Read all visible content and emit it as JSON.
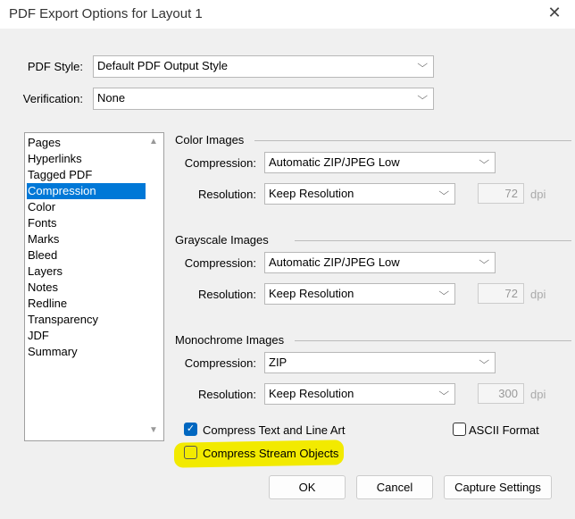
{
  "title": "PDF Export Options for Layout 1",
  "pdf_style": {
    "label": "PDF Style:",
    "value": "Default PDF Output Style"
  },
  "verification": {
    "label": "Verification:",
    "value": "None"
  },
  "categories": [
    "Pages",
    "Hyperlinks",
    "Tagged PDF",
    "Compression",
    "Color",
    "Fonts",
    "Marks",
    "Bleed",
    "Layers",
    "Notes",
    "Redline",
    "Transparency",
    "JDF",
    "Summary"
  ],
  "selected_category": "Compression",
  "groups": [
    {
      "title": "Color Images",
      "compression_label": "Compression:",
      "compression": "Automatic ZIP/JPEG Low",
      "resolution_label": "Resolution:",
      "resolution": "Keep Resolution",
      "dpi_value": "72",
      "dpi_unit": "dpi"
    },
    {
      "title": "Grayscale Images",
      "compression_label": "Compression:",
      "compression": "Automatic ZIP/JPEG Low",
      "resolution_label": "Resolution:",
      "resolution": "Keep Resolution",
      "dpi_value": "72",
      "dpi_unit": "dpi"
    },
    {
      "title": "Monochrome Images",
      "compression_label": "Compression:",
      "compression": "ZIP",
      "resolution_label": "Resolution:",
      "resolution": "Keep Resolution",
      "dpi_value": "300",
      "dpi_unit": "dpi"
    }
  ],
  "options": {
    "compress_text": {
      "label": "Compress Text and Line Art",
      "checked": true
    },
    "ascii": {
      "label": "ASCII Format",
      "checked": false
    },
    "compress_stream": {
      "label": "Compress Stream Objects",
      "checked": false
    }
  },
  "buttons": {
    "ok": "OK",
    "cancel": "Cancel",
    "capture": "Capture Settings"
  },
  "colors": {
    "accent": "#0078d7",
    "highlight": "#f2ea00"
  }
}
